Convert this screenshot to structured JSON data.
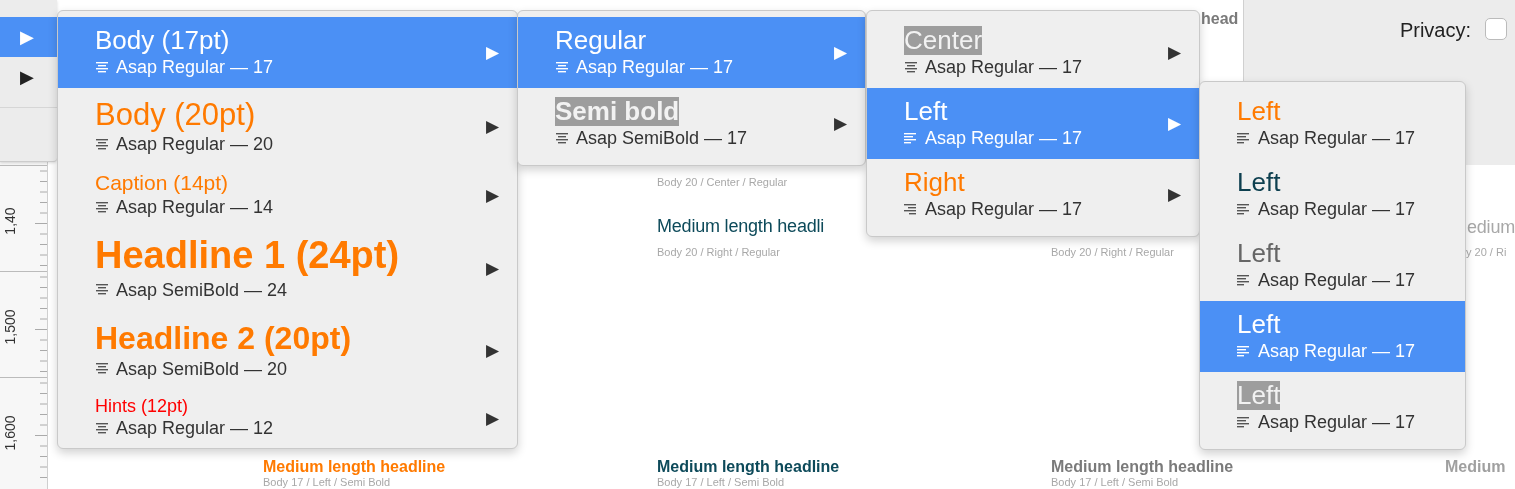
{
  "left_panel": {
    "items": [
      {
        "glyph": "▶",
        "selected": true
      },
      {
        "glyph": "▶",
        "selected": false
      }
    ]
  },
  "inspector": {
    "label": "Privacy:",
    "checked": false
  },
  "ruler": {
    "labels": [
      "1,40",
      "1,500",
      "1,600"
    ]
  },
  "canvas_texts": [
    {
      "text": "Body 20 / Center / Regular",
      "kind": "caption",
      "color": "#a8a8a8"
    },
    {
      "text": "Medium length headli",
      "kind": "headline",
      "color": "#0d4a5a"
    },
    {
      "text": "Body 20 / Right / Regular",
      "kind": "caption",
      "color": "#a8a8a8"
    },
    {
      "text": "Body 20 / Right / Regular",
      "kind": "caption",
      "color": "#a8a8a8"
    },
    {
      "text": "Medium length headline",
      "kind": "bold",
      "color": "#ff7a00"
    },
    {
      "text": "Body 17 / Left / Semi Bold",
      "kind": "caption",
      "color": "#a8a8a8"
    },
    {
      "text": "Medium length headline",
      "kind": "bold",
      "color": "#0d4a5a"
    },
    {
      "text": "Body 17 / Left / Semi Bold",
      "kind": "caption",
      "color": "#a8a8a8"
    },
    {
      "text": "Medium length headline",
      "kind": "bold",
      "color": "#7a7a7a"
    },
    {
      "text": "Body 17 / Left / Semi Bold",
      "kind": "caption",
      "color": "#a8a8a8"
    },
    {
      "text": "Medium",
      "kind": "bold",
      "color": "#a0a0a0"
    },
    {
      "text": "head",
      "kind": "bold",
      "color": "#7a7a7a"
    },
    {
      "text": "edium",
      "kind": "headline",
      "color": "#a8a8a8"
    },
    {
      "text": "y 20 / Ri",
      "kind": "caption",
      "color": "#a8a8a8"
    }
  ],
  "menus": [
    {
      "items": [
        {
          "title": "Body (17pt)",
          "kind": "body",
          "marked": false,
          "icon": {
            "kind": "center"
          },
          "font": "Asap Regular — 17",
          "arrow": "▶",
          "selected": true
        },
        {
          "title": "Body (20pt)",
          "kind": "body-large",
          "color": "#ff7a00",
          "marked": false,
          "icon": {
            "kind": "center"
          },
          "font": "Asap Regular — 20",
          "arrow": "▶",
          "selected": false
        },
        {
          "title": "Caption (14pt)",
          "kind": "caption",
          "color": "#ff7a00",
          "marked": false,
          "icon": {
            "kind": "center"
          },
          "font": "Asap Regular — 14",
          "arrow": "▶",
          "selected": false
        },
        {
          "title": "Headline 1 (24pt)",
          "kind": "headline1",
          "color": "#ff7a00",
          "marked": false,
          "icon": {
            "kind": "center"
          },
          "font": "Asap SemiBold — 24",
          "arrow": "▶",
          "selected": false
        },
        {
          "title": "Headline 2 (20pt)",
          "kind": "headline2",
          "color": "#ff7a00",
          "marked": false,
          "icon": {
            "kind": "center"
          },
          "font": "Asap SemiBold — 20",
          "arrow": "▶",
          "selected": false
        },
        {
          "title": "Hints (12pt)",
          "kind": "hint",
          "color": "#ff0000",
          "marked": false,
          "icon": {
            "kind": "center"
          },
          "font": "Asap Regular — 12",
          "arrow": "▶",
          "selected": false
        }
      ]
    },
    {
      "items": [
        {
          "title": "Regular",
          "kind": "regular",
          "marked": false,
          "icon": {
            "kind": "center"
          },
          "font": "Asap Regular — 17",
          "arrow": "▶",
          "selected": true
        },
        {
          "title": "Semi bold",
          "kind": "semibold",
          "marked": true,
          "icon": {
            "kind": "center"
          },
          "font": "Asap SemiBold — 17",
          "arrow": "▶",
          "selected": false
        }
      ]
    },
    {
      "items": [
        {
          "title": "Center",
          "kind": "regular",
          "marked": true,
          "icon": {
            "kind": "center"
          },
          "font": "Asap Regular — 17",
          "arrow": "▶",
          "selected": false
        },
        {
          "title": "Left",
          "kind": "regular",
          "marked": false,
          "icon": {
            "kind": "left"
          },
          "font": "Asap Regular — 17",
          "arrow": "▶",
          "selected": true
        },
        {
          "title": "Right",
          "kind": "regular",
          "color": "#ff7a00",
          "marked": false,
          "icon": {
            "kind": "right"
          },
          "font": "Asap Regular — 17",
          "arrow": "▶",
          "selected": false
        }
      ]
    },
    {
      "items": [
        {
          "title": "Left",
          "kind": "regular",
          "color": "#ff7a00",
          "marked": false,
          "icon": {
            "kind": "left"
          },
          "font": "Asap Regular — 17",
          "selected": false
        },
        {
          "title": "Left",
          "kind": "regular",
          "color": "#0d3f4f",
          "marked": false,
          "icon": {
            "kind": "left"
          },
          "font": "Asap Regular — 17",
          "selected": false
        },
        {
          "title": "Left",
          "kind": "regular",
          "color": "#666666",
          "marked": false,
          "icon": {
            "kind": "left"
          },
          "font": "Asap Regular — 17",
          "selected": false
        },
        {
          "title": "Left",
          "kind": "regular",
          "marked": false,
          "icon": {
            "kind": "left"
          },
          "font": "Asap Regular — 17",
          "selected": true
        },
        {
          "title": "Left",
          "kind": "regular",
          "marked": true,
          "icon": {
            "kind": "left"
          },
          "font": "Asap Regular — 17",
          "selected": false
        }
      ]
    }
  ]
}
